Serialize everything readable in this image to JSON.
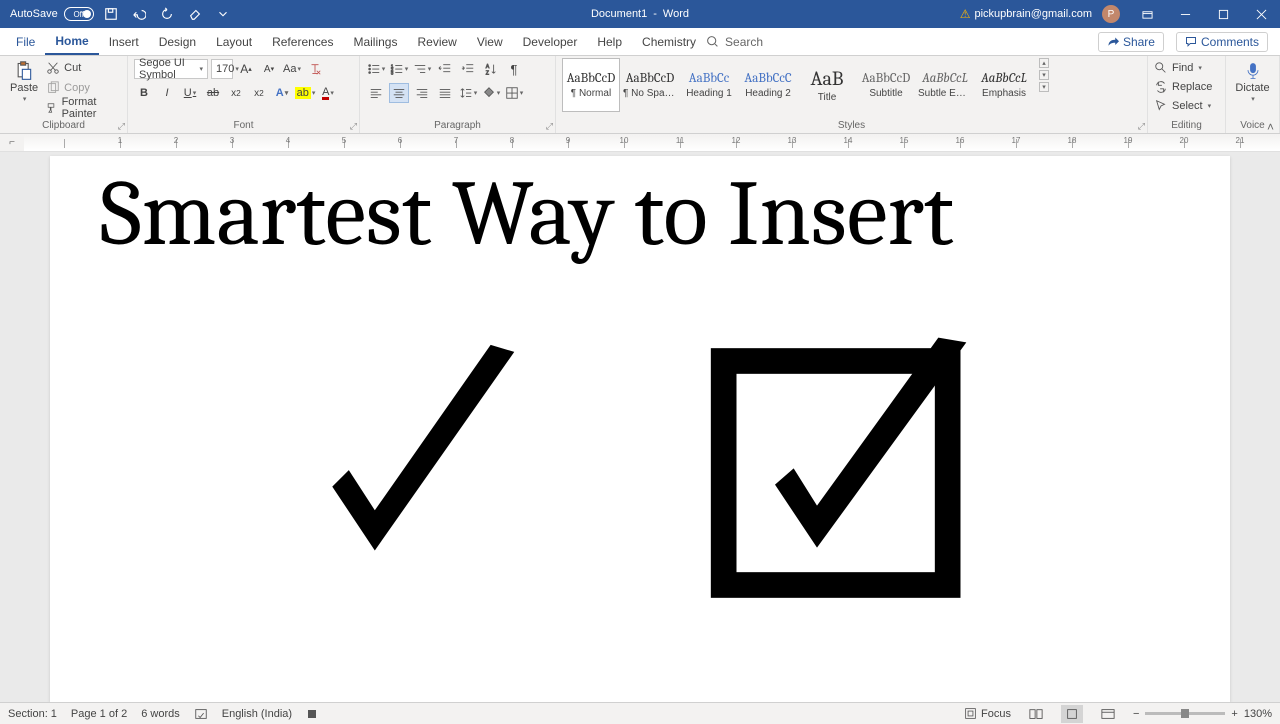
{
  "titlebar": {
    "autosave_label": "AutoSave",
    "autosave_state": "Off",
    "doc_name": "Document1",
    "app_name": "Word",
    "user_email": "pickupbrain@gmail.com",
    "avatar_initial": "P"
  },
  "tabs": {
    "file": "File",
    "items": [
      "Home",
      "Insert",
      "Design",
      "Layout",
      "References",
      "Mailings",
      "Review",
      "View",
      "Developer",
      "Help",
      "Chemistry"
    ],
    "active": "Home",
    "search_placeholder": "Search",
    "share": "Share",
    "comments": "Comments"
  },
  "ribbon": {
    "clipboard": {
      "label": "Clipboard",
      "paste": "Paste",
      "cut": "Cut",
      "copy": "Copy",
      "format_painter": "Format Painter"
    },
    "font": {
      "label": "Font",
      "name": "Segoe UI Symbol",
      "size": "170"
    },
    "paragraph": {
      "label": "Paragraph"
    },
    "styles": {
      "label": "Styles",
      "items": [
        {
          "preview": "AaBbCcD",
          "name": "¶ Normal",
          "cls": "",
          "sel": true
        },
        {
          "preview": "AaBbCcD",
          "name": "¶ No Spac...",
          "cls": "",
          "sel": false
        },
        {
          "preview": "AaBbCc",
          "name": "Heading 1",
          "cls": "heading",
          "sel": false
        },
        {
          "preview": "AaBbCcC",
          "name": "Heading 2",
          "cls": "heading",
          "sel": false
        },
        {
          "preview": "AaB",
          "name": "Title",
          "cls": "title",
          "sel": false
        },
        {
          "preview": "AaBbCcD",
          "name": "Subtitle",
          "cls": "subtle",
          "sel": false
        },
        {
          "preview": "AaBbCcL",
          "name": "Subtle Em...",
          "cls": "subtle emph",
          "sel": false
        },
        {
          "preview": "AaBbCcL",
          "name": "Emphasis",
          "cls": "emph",
          "sel": false
        }
      ]
    },
    "editing": {
      "label": "Editing",
      "find": "Find",
      "replace": "Replace",
      "select": "Select"
    },
    "voice": {
      "label": "Voice",
      "dictate": "Dictate"
    }
  },
  "document": {
    "title_text": "Smartest Way to Insert"
  },
  "statusbar": {
    "section": "Section: 1",
    "page": "Page 1 of 2",
    "words": "6 words",
    "lang": "English (India)",
    "focus": "Focus",
    "zoom": "130%"
  }
}
